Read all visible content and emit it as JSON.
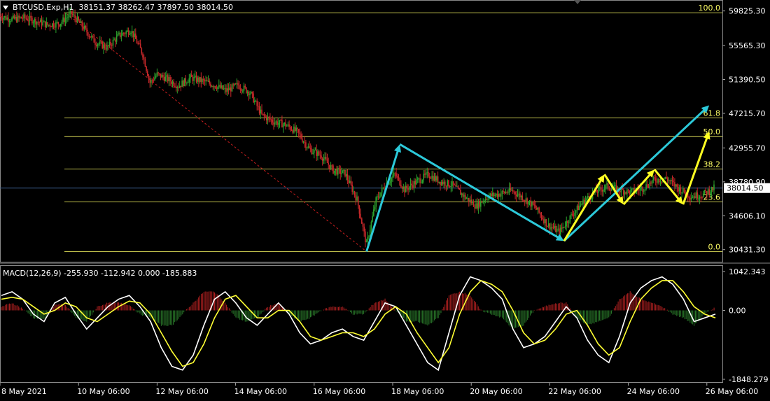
{
  "main_header": {
    "symbol": "BTCUSD.Exp,H1",
    "ohlc": "38151.37 38262.47 37897.50 38014.50"
  },
  "macd_header": {
    "label": "MACD(12,26,9) -255.930 -112.942 0.000 -185.883"
  },
  "colors": {
    "background": "#000000",
    "bull_candle": "#2ca02c",
    "bear_candle": "#c8282a",
    "fib_line": "#ffff66",
    "cyan_arrow": "#2cc9d9",
    "yellow_arrow": "#ffff22",
    "macd_line": "#ffffff",
    "signal_line": "#ffff33",
    "trendline": "#c81e1e",
    "current_price_line": "#3a5a8a"
  },
  "chart_data": [
    {
      "type": "candlestick",
      "title": "BTCUSD.Exp,H1",
      "price_axis_ticks": [
        "59825.30",
        "55565.30",
        "51390.50",
        "47215.70",
        "42955.70",
        "38780.90",
        "34606.10",
        "30431.30"
      ],
      "current_price": "38014.50",
      "time_axis_ticks": [
        "8 May 2021",
        "10 May 06:00",
        "12 May 06:00",
        "14 May 06:00",
        "16 May 06:00",
        "18 May 06:00",
        "20 May 06:00",
        "22 May 06:00",
        "24 May 06:00",
        "26 May 06:00"
      ],
      "fibonacci_levels": [
        {
          "label": "100.0",
          "price": 59600
        },
        {
          "label": "61.8",
          "price": 46650
        },
        {
          "label": "50.0",
          "price": 44350
        },
        {
          "label": "38.2",
          "price": 40350
        },
        {
          "label": "23.6",
          "price": 36320
        },
        {
          "label": "0.0",
          "price": 30200
        }
      ],
      "close_path": [
        [
          0,
          59200
        ],
        [
          5,
          58800
        ],
        [
          10,
          59000
        ],
        [
          15,
          58600
        ],
        [
          20,
          58100
        ],
        [
          25,
          58300
        ],
        [
          30,
          59500
        ],
        [
          35,
          57800
        ],
        [
          40,
          56000
        ],
        [
          45,
          55300
        ],
        [
          50,
          56800
        ],
        [
          55,
          57500
        ],
        [
          60,
          54500
        ],
        [
          63,
          51000
        ],
        [
          66,
          52000
        ],
        [
          70,
          51500
        ],
        [
          75,
          50600
        ],
        [
          80,
          51600
        ],
        [
          85,
          51200
        ],
        [
          90,
          50700
        ],
        [
          95,
          50000
        ],
        [
          100,
          50700
        ],
        [
          105,
          49800
        ],
        [
          110,
          47000
        ],
        [
          115,
          46200
        ],
        [
          120,
          45800
        ],
        [
          125,
          44900
        ],
        [
          130,
          42800
        ],
        [
          135,
          42000
        ],
        [
          140,
          40200
        ],
        [
          145,
          39800
        ],
        [
          150,
          36600
        ],
        [
          154,
          31000
        ],
        [
          158,
          36500
        ],
        [
          162,
          38500
        ],
        [
          166,
          39700
        ],
        [
          170,
          37800
        ],
        [
          175,
          38800
        ],
        [
          180,
          39700
        ],
        [
          185,
          38800
        ],
        [
          190,
          38400
        ],
        [
          195,
          37000
        ],
        [
          200,
          35800
        ],
        [
          205,
          37000
        ],
        [
          210,
          37300
        ],
        [
          215,
          37700
        ],
        [
          220,
          36800
        ],
        [
          225,
          35600
        ],
        [
          230,
          33500
        ],
        [
          235,
          32600
        ],
        [
          240,
          34600
        ],
        [
          245,
          36300
        ],
        [
          250,
          37500
        ],
        [
          255,
          38200
        ],
        [
          260,
          37800
        ],
        [
          265,
          37500
        ],
        [
          270,
          38000
        ],
        [
          275,
          39000
        ],
        [
          280,
          39200
        ],
        [
          285,
          38000
        ],
        [
          290,
          37000
        ],
        [
          295,
          37200
        ],
        [
          300,
          38014
        ]
      ],
      "price_min": 29200,
      "price_max": 61000,
      "trendline": {
        "from": [
          28,
          59500
        ],
        "to": [
          154,
          30200
        ]
      },
      "cyan_arrows": [
        {
          "from": [
            154,
            30200
          ],
          "to": [
            168,
            43400
          ]
        },
        {
          "from": [
            168,
            43400
          ],
          "to": [
            237,
            31500
          ]
        },
        {
          "from": [
            237,
            31500
          ],
          "to": [
            298,
            48200
          ]
        }
      ],
      "yellow_arrows": [
        {
          "from": [
            237,
            31500
          ],
          "to": [
            254,
            39700
          ]
        },
        {
          "from": [
            254,
            39700
          ],
          "to": [
            262,
            36000
          ]
        },
        {
          "from": [
            262,
            36000
          ],
          "to": [
            275,
            40300
          ]
        },
        {
          "from": [
            275,
            40300
          ],
          "to": [
            287,
            36000
          ]
        },
        {
          "from": [
            287,
            36000
          ],
          "to": [
            298,
            45000
          ]
        }
      ]
    },
    {
      "type": "line",
      "title": "MACD(12,26,9)",
      "axis_ticks": [
        "1042.343",
        "0.00",
        "-1848.279"
      ],
      "ylim": [
        -1848.279,
        1042.343
      ],
      "series": [
        {
          "name": "MACD",
          "values": [
            400,
            500,
            300,
            -100,
            -300,
            200,
            350,
            -100,
            -500,
            -200,
            100,
            300,
            400,
            100,
            -300,
            -1000,
            -1500,
            -1600,
            -1200,
            -400,
            300,
            500,
            200,
            -200,
            -400,
            -100,
            200,
            -100,
            -600,
            -900,
            -800,
            -600,
            -500,
            -700,
            -800,
            -300,
            200,
            100,
            -400,
            -900,
            -1400,
            -1600,
            -600,
            400,
            900,
            800,
            600,
            300,
            -500,
            -1000,
            -900,
            -700,
            -300,
            100,
            -200,
            -800,
            -1200,
            -1400,
            -700,
            200,
            600,
            800,
            900,
            700,
            300,
            -300,
            -200,
            -100
          ]
        },
        {
          "name": "Signal",
          "values": [
            300,
            350,
            300,
            100,
            -100,
            0,
            200,
            100,
            -200,
            -300,
            -100,
            100,
            250,
            200,
            -100,
            -600,
            -1100,
            -1500,
            -1400,
            -900,
            -200,
            300,
            400,
            100,
            -200,
            -200,
            0,
            0,
            -300,
            -700,
            -800,
            -700,
            -600,
            -600,
            -700,
            -500,
            -100,
            100,
            -100,
            -600,
            -1000,
            -1400,
            -1000,
            -100,
            500,
            800,
            700,
            500,
            0,
            -600,
            -900,
            -800,
            -500,
            -100,
            0,
            -400,
            -900,
            -1200,
            -1000,
            -300,
            300,
            600,
            800,
            800,
            500,
            100,
            -100,
            -200
          ]
        }
      ],
      "histogram": [
        100,
        200,
        50,
        -200,
        -250,
        150,
        150,
        -200,
        -300,
        100,
        200,
        200,
        150,
        -100,
        -200,
        -400,
        -400,
        -100,
        200,
        500,
        500,
        200,
        -200,
        -300,
        -200,
        100,
        200,
        -100,
        -300,
        -200,
        0,
        100,
        100,
        -100,
        -100,
        200,
        300,
        0,
        -300,
        -300,
        -400,
        -200,
        400,
        500,
        400,
        0,
        -100,
        -200,
        -500,
        -400,
        0,
        100,
        200,
        200,
        -200,
        -400,
        -300,
        -200,
        300,
        500,
        300,
        200,
        100,
        -100,
        -200,
        -400,
        -100,
        100
      ]
    }
  ]
}
